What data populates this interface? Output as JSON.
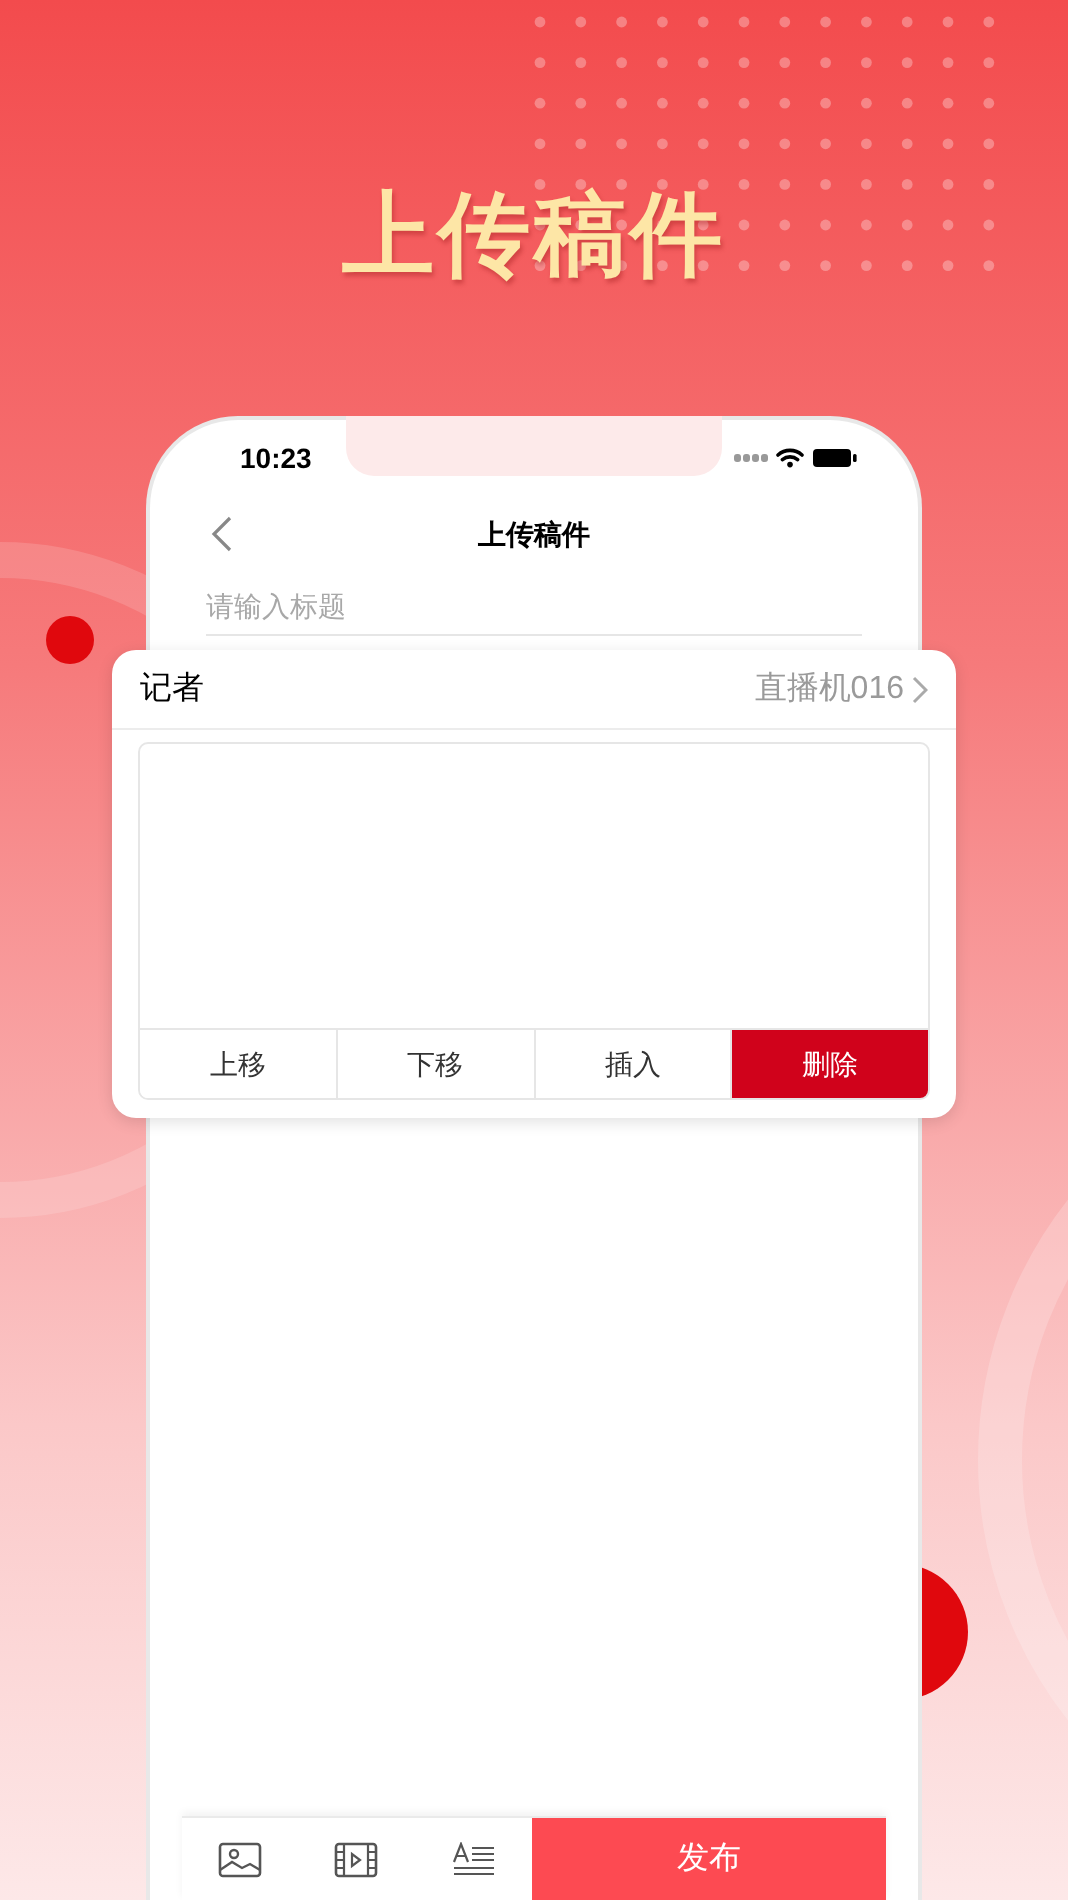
{
  "headline": "上传稿件",
  "phone": {
    "status_bar": {
      "time": "10:23"
    },
    "nav": {
      "title": "上传稿件"
    },
    "title_field": {
      "placeholder": "请输入标题"
    },
    "card": {
      "label": "记者",
      "value": "直播机016",
      "actions": [
        {
          "label": "上移",
          "kind": "normal"
        },
        {
          "label": "下移",
          "kind": "normal"
        },
        {
          "label": "插入",
          "kind": "normal"
        },
        {
          "label": "删除",
          "kind": "danger"
        }
      ]
    },
    "toolbar": {
      "publish": "发布"
    }
  }
}
